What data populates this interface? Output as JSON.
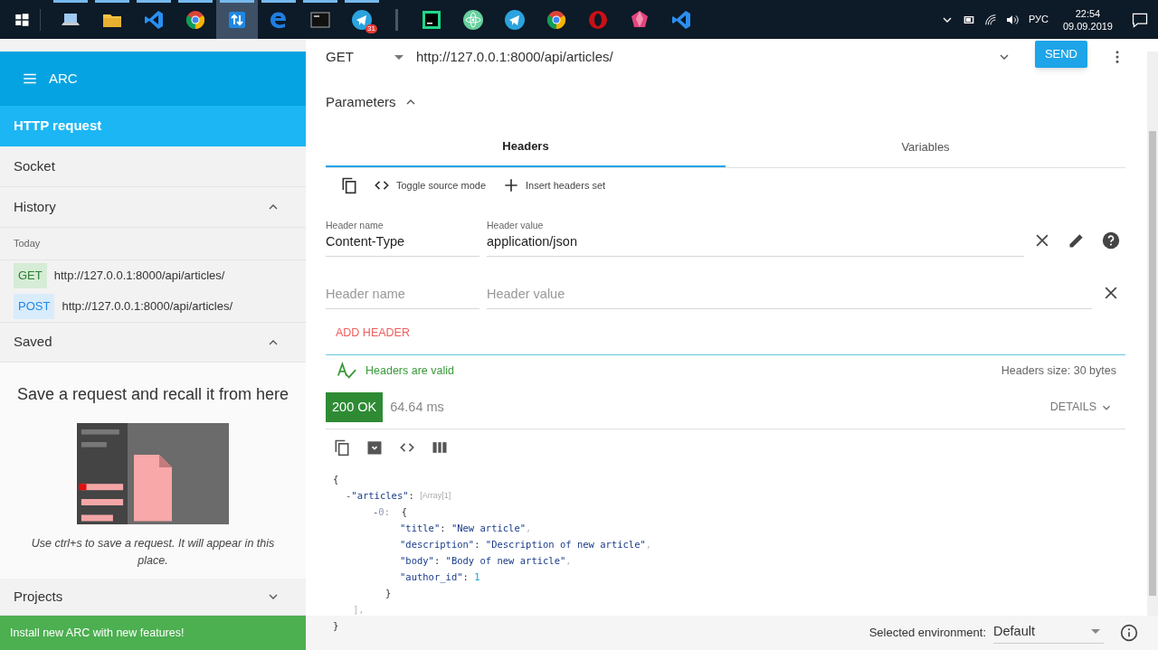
{
  "taskbar": {
    "apps": [
      {
        "kind": "laptop",
        "selected": false,
        "running": true
      },
      {
        "kind": "folder",
        "selected": false,
        "running": true
      },
      {
        "kind": "ribbon",
        "selected": false,
        "running": true
      },
      {
        "kind": "chrome",
        "selected": false,
        "running": true
      },
      {
        "kind": "arrows",
        "selected": true,
        "running": true
      },
      {
        "kind": "edge",
        "selected": false,
        "running": true
      },
      {
        "kind": "terminal",
        "selected": false,
        "running": true
      },
      {
        "kind": "telegram",
        "selected": false,
        "running": true,
        "badge": "31"
      },
      {
        "kind": "separator"
      },
      {
        "kind": "pc",
        "selected": false,
        "running": false
      },
      {
        "kind": "atom",
        "selected": false,
        "running": false
      },
      {
        "kind": "telegram",
        "selected": false,
        "running": false
      },
      {
        "kind": "chrome",
        "selected": false,
        "running": false
      },
      {
        "kind": "opera",
        "selected": false,
        "running": false
      },
      {
        "kind": "gem",
        "selected": false,
        "running": false
      },
      {
        "kind": "ribbon",
        "selected": false,
        "running": false
      }
    ],
    "language": "РУС",
    "time": "22:54",
    "date": "09.09.2019"
  },
  "sidebar": {
    "title": "ARC",
    "items": [
      {
        "label": "HTTP request",
        "selected": true
      },
      {
        "label": "Socket",
        "selected": false
      }
    ],
    "history": {
      "label": "History",
      "expanded": true,
      "group": "Today",
      "entries": [
        {
          "method": "GET",
          "url": "http://127.0.0.1:8000/api/articles/"
        },
        {
          "method": "POST",
          "url": "http://127.0.0.1:8000/api/articles/"
        }
      ]
    },
    "saved": {
      "label": "Saved",
      "expanded": true,
      "title": "Save a request and recall it from here",
      "hint": "Use ctrl+s to save a request. It will appear in this place."
    },
    "projects": {
      "label": "Projects",
      "expanded": false
    },
    "footer": "Install new ARC with new features!"
  },
  "request": {
    "method": "GET",
    "url": "http://127.0.0.1:8000/api/articles/",
    "send": "SEND"
  },
  "parameters": {
    "label": "Parameters",
    "expanded": true,
    "tabs": [
      {
        "label": "Headers",
        "selected": true
      },
      {
        "label": "Variables",
        "selected": false
      }
    ],
    "actions": [
      "Toggle source mode",
      "Insert headers set"
    ],
    "headers": [
      {
        "name_label": "Header name",
        "value_label": "Header value",
        "name": "Content-Type",
        "value": "application/json"
      },
      {
        "name_placeholder": "Header name",
        "value_placeholder": "Header value"
      }
    ],
    "add_header": "ADD HEADER",
    "validation": "Headers are valid",
    "size": "Headers size: 30 bytes"
  },
  "response": {
    "status": "200 OK",
    "time": "64.64 ms",
    "details": "DETAILS",
    "json": {
      "open": "{",
      "close": "}",
      "children": [
        {
          "toggle": "-",
          "key": "\"articles\"",
          "colon": ":",
          "hint": "[Array[1]",
          "close": "],",
          "children": [
            {
              "toggle": "-",
              "key": "0:",
              "open": "{",
              "close": "}",
              "children": [
                {
                  "key": "\"title\"",
                  "colon": ":",
                  "value": "\"New article\"",
                  "kind": "string",
                  "comma": ","
                },
                {
                  "key": "\"description\"",
                  "colon": ":",
                  "value": "\"Description of new article\"",
                  "kind": "string",
                  "comma": ","
                },
                {
                  "key": "\"body\"",
                  "colon": ":",
                  "value": "\"Body of new article\"",
                  "kind": "string",
                  "comma": ","
                },
                {
                  "key": "\"author_id\"",
                  "colon": ":",
                  "value": "1",
                  "kind": "number"
                }
              ]
            }
          ]
        }
      ]
    }
  },
  "status_bar": {
    "label": "Selected environment:",
    "environment": "Default"
  }
}
